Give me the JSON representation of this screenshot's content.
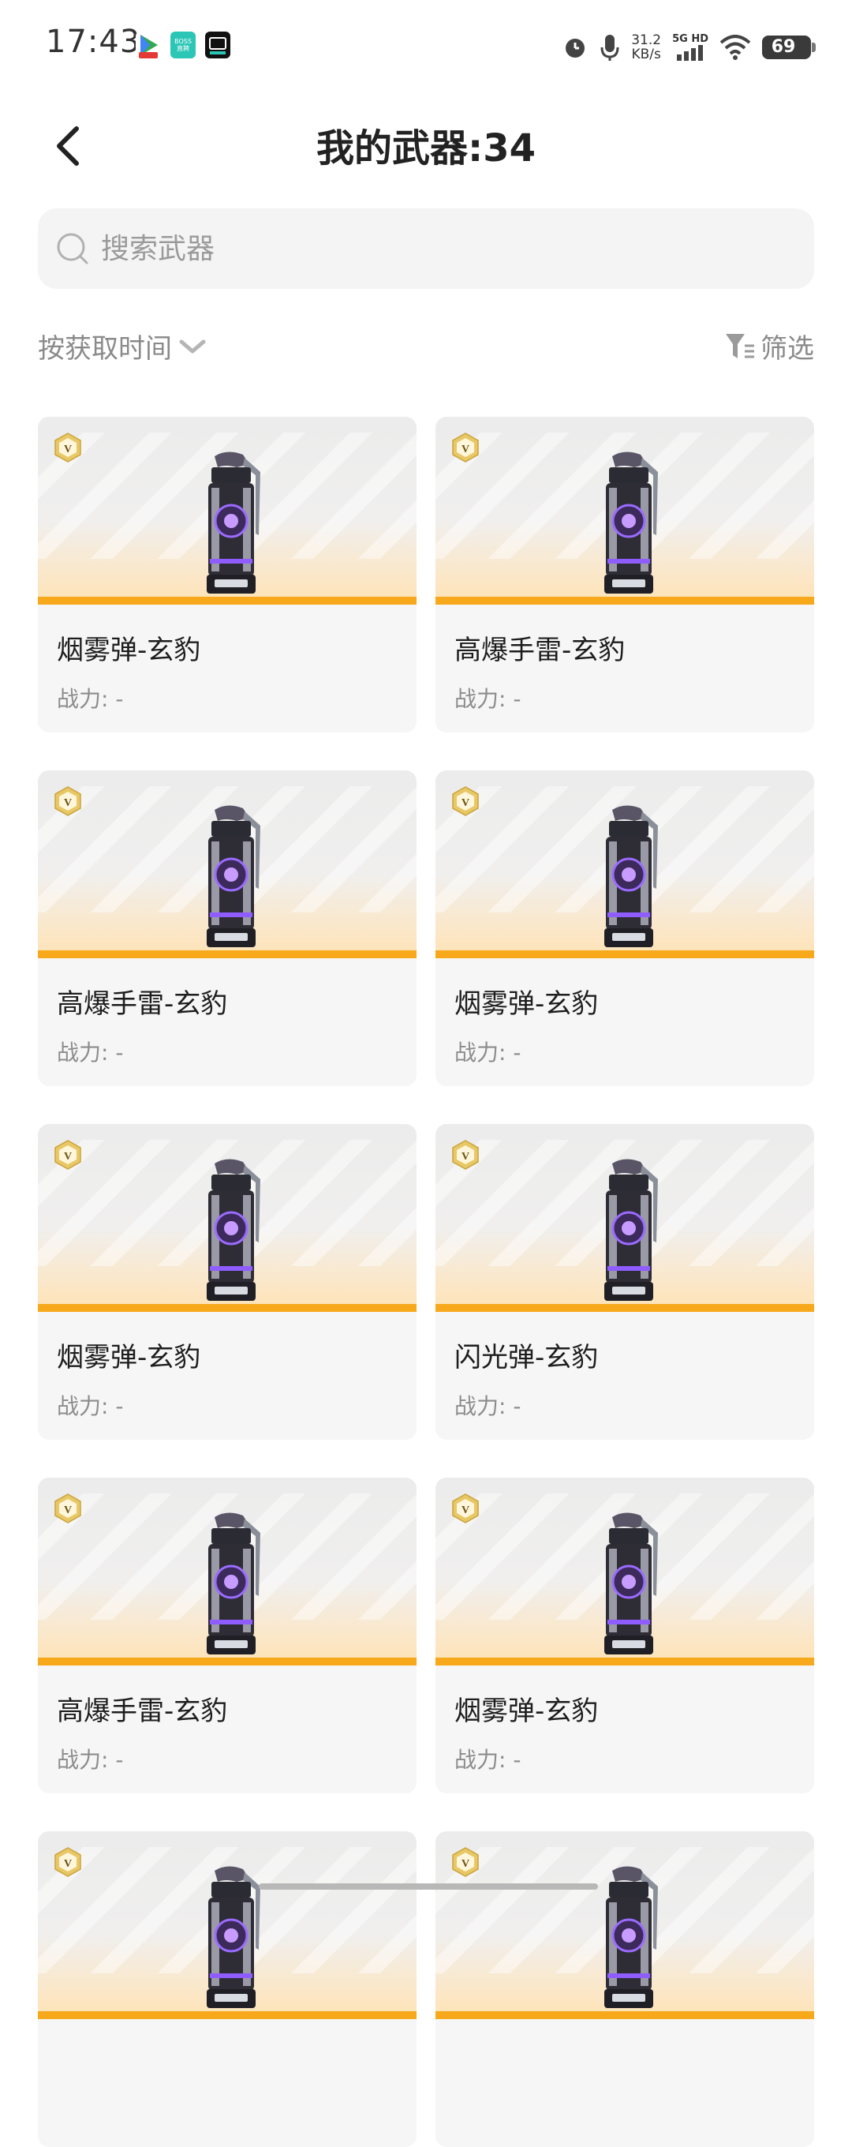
{
  "status_bar": {
    "time": "17:43",
    "app_icons": [
      "play-store-icon",
      "boss-zhipin-icon",
      "dark-app-icon"
    ],
    "boss_icon_text": "BOSS 直聘",
    "net_speed_value": "31.2",
    "net_speed_unit": "KB/s",
    "network_type": "5G HD",
    "battery": "69"
  },
  "header": {
    "title": "我的武器:34"
  },
  "search": {
    "placeholder": "搜索武器"
  },
  "toolbar": {
    "sort_label": "按获取时间",
    "filter_label": "筛选"
  },
  "colors": {
    "accent_orange": "#f7a81b",
    "card_bg": "#f6f6f6",
    "badge_gold": "#d9b54a"
  },
  "weapons": [
    {
      "name": "烟雾弹-玄豹",
      "power": "战力: -"
    },
    {
      "name": "高爆手雷-玄豹",
      "power": "战力: -"
    },
    {
      "name": "高爆手雷-玄豹",
      "power": "战力: -"
    },
    {
      "name": "烟雾弹-玄豹",
      "power": "战力: -"
    },
    {
      "name": "烟雾弹-玄豹",
      "power": "战力: -"
    },
    {
      "name": "闪光弹-玄豹",
      "power": "战力: -"
    },
    {
      "name": "高爆手雷-玄豹",
      "power": "战力: -"
    },
    {
      "name": "烟雾弹-玄豹",
      "power": "战力: -"
    },
    {
      "name": "",
      "power": ""
    },
    {
      "name": "",
      "power": ""
    }
  ]
}
